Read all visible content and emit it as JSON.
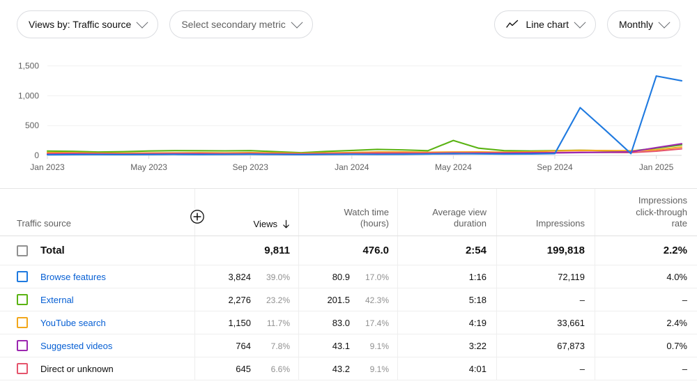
{
  "toolbar": {
    "primary_metric": "Views by: Traffic source",
    "secondary_metric_placeholder": "Select secondary metric",
    "chart_type": "Line chart",
    "chart_type_icon": "line-chart-icon",
    "interval": "Monthly",
    "chevron_icon": "chevron-down-icon"
  },
  "chart_data": {
    "type": "line",
    "title": "",
    "xlabel": "",
    "ylabel": "",
    "ylim": [
      0,
      1600
    ],
    "yticks": [
      "0",
      "500",
      "1,000",
      "1,500"
    ],
    "ytick_values": [
      0,
      500,
      1000,
      1500
    ],
    "xticks": [
      "Jan 2023",
      "May 2023",
      "Sep 2023",
      "Jan 2024",
      "May 2024",
      "Sep 2024",
      "Jan 2025"
    ],
    "x": [
      "Jan 2023",
      "Feb 2023",
      "Mar 2023",
      "Apr 2023",
      "May 2023",
      "Jun 2023",
      "Jul 2023",
      "Aug 2023",
      "Sep 2023",
      "Oct 2023",
      "Nov 2023",
      "Dec 2023",
      "Jan 2024",
      "Feb 2024",
      "Mar 2024",
      "Apr 2024",
      "May 2024",
      "Jun 2024",
      "Jul 2024",
      "Aug 2024",
      "Sep 2024",
      "Oct 2024",
      "Nov 2024",
      "Dec 2024",
      "Jan 2025",
      "Feb 2025"
    ],
    "grid": true,
    "legend_position": "table",
    "series": [
      {
        "name": "Browse features",
        "color": "#1f7ae0",
        "values": [
          10,
          12,
          14,
          12,
          14,
          16,
          14,
          16,
          18,
          16,
          14,
          16,
          18,
          16,
          18,
          22,
          30,
          26,
          22,
          24,
          30,
          800,
          420,
          30,
          1330,
          1250
        ]
      },
      {
        "name": "External",
        "color": "#5ab313",
        "values": [
          72,
          68,
          56,
          62,
          74,
          80,
          78,
          76,
          80,
          62,
          44,
          66,
          82,
          100,
          92,
          78,
          250,
          120,
          80,
          74,
          80,
          86,
          78,
          72,
          120,
          175
        ]
      },
      {
        "name": "YouTube search",
        "color": "#f2a71b",
        "values": [
          48,
          44,
          38,
          36,
          40,
          42,
          44,
          42,
          46,
          42,
          34,
          42,
          48,
          56,
          58,
          52,
          56,
          58,
          54,
          60,
          76,
          84,
          80,
          78,
          92,
          140
        ]
      },
      {
        "name": "Suggested videos",
        "color": "#9c27b0",
        "values": [
          16,
          18,
          16,
          14,
          16,
          18,
          18,
          16,
          18,
          16,
          14,
          16,
          18,
          20,
          22,
          24,
          26,
          30,
          34,
          38,
          42,
          48,
          52,
          60,
          130,
          195
        ]
      },
      {
        "name": "Direct or unknown",
        "color": "#e5546c",
        "values": [
          30,
          34,
          30,
          26,
          32,
          34,
          34,
          32,
          34,
          30,
          26,
          32,
          36,
          40,
          42,
          40,
          44,
          44,
          42,
          44,
          48,
          52,
          50,
          48,
          70,
          110
        ]
      }
    ]
  },
  "table": {
    "headers": {
      "source": "Traffic source",
      "views": "Views",
      "watch_time": "Watch time\n(hours)",
      "watch_time_l1": "Watch time",
      "watch_time_l2": "(hours)",
      "avg_view_duration_l1": "Average view",
      "avg_view_duration_l2": "duration",
      "impressions": "Impressions",
      "ctr_l1": "Impressions",
      "ctr_l2": "click-through",
      "ctr_l3": "rate",
      "sort_icon": "sort-descending-icon",
      "add_metric_icon": "plus-circle-icon"
    },
    "total": {
      "label": "Total",
      "views": "9,811",
      "watch_time": "476.0",
      "avg_view_duration": "2:54",
      "impressions": "199,818",
      "ctr": "2.2%",
      "checkbox_color": "#909090"
    },
    "rows": [
      {
        "label": "Browse features",
        "checkbox_color": "#1f7ae0",
        "is_link": true,
        "views": "3,824",
        "views_pct": "39.0%",
        "watch_time": "80.9",
        "watch_time_pct": "17.0%",
        "avg_view_duration": "1:16",
        "impressions": "72,119",
        "ctr": "4.0%"
      },
      {
        "label": "External",
        "checkbox_color": "#5ab313",
        "is_link": true,
        "views": "2,276",
        "views_pct": "23.2%",
        "watch_time": "201.5",
        "watch_time_pct": "42.3%",
        "avg_view_duration": "5:18",
        "impressions": "–",
        "ctr": "–"
      },
      {
        "label": "YouTube search",
        "checkbox_color": "#f2a71b",
        "is_link": true,
        "views": "1,150",
        "views_pct": "11.7%",
        "watch_time": "83.0",
        "watch_time_pct": "17.4%",
        "avg_view_duration": "4:19",
        "impressions": "33,661",
        "ctr": "2.4%"
      },
      {
        "label": "Suggested videos",
        "checkbox_color": "#9c27b0",
        "is_link": true,
        "views": "764",
        "views_pct": "7.8%",
        "watch_time": "43.1",
        "watch_time_pct": "9.1%",
        "avg_view_duration": "3:22",
        "impressions": "67,873",
        "ctr": "0.7%"
      },
      {
        "label": "Direct or unknown",
        "checkbox_color": "#e5546c",
        "is_link": false,
        "views": "645",
        "views_pct": "6.6%",
        "watch_time": "43.2",
        "watch_time_pct": "9.1%",
        "avg_view_duration": "4:01",
        "impressions": "–",
        "ctr": "–"
      }
    ]
  }
}
